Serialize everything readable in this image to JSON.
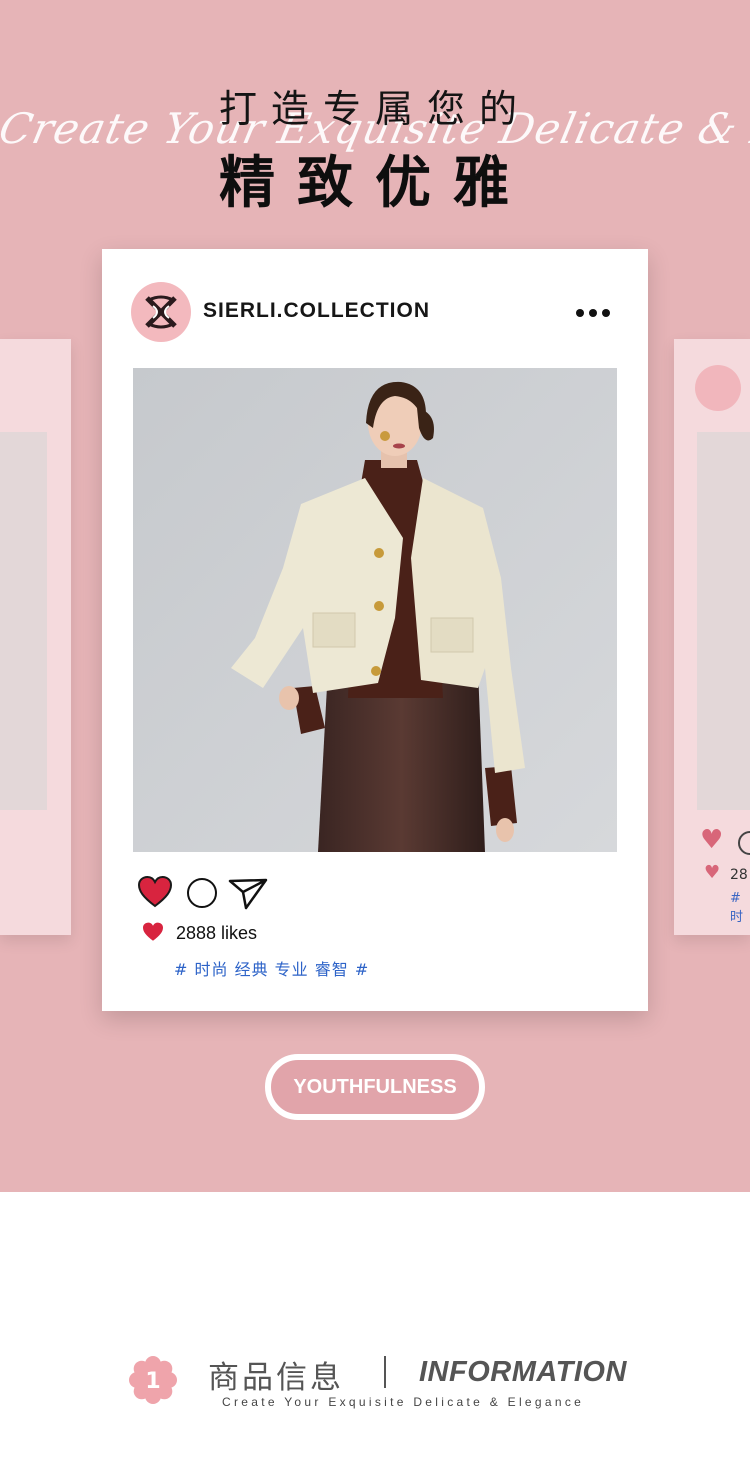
{
  "hero": {
    "title_line1": "打造专属您的",
    "title_script": "Create Your Exquisite Delicate & Elegance",
    "title_line2": "精致优雅",
    "background_color": "#e6b4b7"
  },
  "post": {
    "username": "SIERLI.COLLECTION",
    "likes": "2888 likes",
    "tags": "# 时尚 经典 专业 睿智 #",
    "heart_color": "#d8243f",
    "tag_color": "#2d63c8",
    "icons": [
      "heart-icon",
      "comment-icon",
      "send-icon",
      "more-icon"
    ]
  },
  "side_post": {
    "likes_partial": "28",
    "tag_partial": "# 时"
  },
  "badge": {
    "label": "YOUTHFULNESS"
  },
  "info": {
    "number": "1",
    "title_cn": "商品信息",
    "title_en": "INFORMATION",
    "subtitle": "Create Your Exquisite Delicate & Elegance"
  }
}
